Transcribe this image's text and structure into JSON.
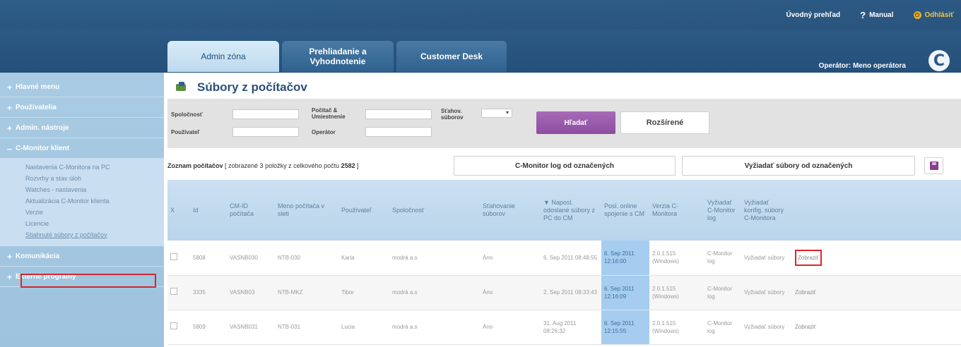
{
  "header": {
    "toplinks": {
      "overview": "Úvodný prehľad",
      "manual_icon": "?",
      "manual": "Manual",
      "logout": "Odhlásiť"
    },
    "tabs": [
      {
        "label": "Admin zóna"
      },
      {
        "label": "Prehliadanie a Vyhodnotenie"
      },
      {
        "label": "Customer Desk"
      }
    ],
    "operator": "Operátor: Meno operátora",
    "logo_letter": "C"
  },
  "sidebar": {
    "items": [
      {
        "label": "Hlavné menu",
        "icon": "+"
      },
      {
        "label": "Používatelia",
        "icon": "+"
      },
      {
        "label": "Admin. nástroje",
        "icon": "+"
      },
      {
        "label": "C-Monitor klient",
        "icon": "–"
      }
    ],
    "sub_items": [
      "Nastavenia C-Monitora na PC",
      "Rozvrhy a stav úloh",
      "Watches - nastavenia",
      "Aktualizácia C-Monitor klienta",
      "Verzie",
      "Licencie",
      "Stiahnuté súbory z počítačov"
    ],
    "bottom_items": [
      {
        "label": "Komunikácia",
        "icon": "+"
      },
      {
        "label": "Externé programy",
        "icon": "+"
      }
    ]
  },
  "main": {
    "title": "Súbory z počítačov",
    "filter": {
      "company_label": "Spoločnosť",
      "user_label": "Používateľ",
      "pc_label": "Počítač & Umiestnenie",
      "operator_label": "Operátor",
      "downloads_label": "Sťahov. súborov",
      "downloads_value": "▾",
      "search_button": "Hľadať",
      "advanced_button": "Rozšírené"
    },
    "list": {
      "prefix": "Zoznam počítačov",
      "bracket_text": "[ zobrazené 3 položky z celkového počtu ",
      "total": "2582",
      "bracket_end": " ]",
      "log_button": "C-Monitor log od označených",
      "request_button": "Vyžiadať súbory od označených"
    },
    "table": {
      "headers": [
        "X",
        "Id",
        "CM-ID počítača",
        "Meno počítača v sieti",
        "Používateľ",
        "Spoločnosť",
        "Sťahovanie súborov",
        "▼ Naposl. odoslané súbory z PC do CM",
        "Posl. online spojenie s CM",
        "Verzia C-Monitora",
        "Vyžiadať C-Monitor log",
        "Vyžiadať konfig. súbory C-Monitora",
        ""
      ],
      "rows": [
        {
          "id": "5808",
          "cmid": "VASNB030",
          "pc": "NTB-030",
          "user": "Karla",
          "company": "modrá a.s",
          "download": "Áno",
          "last_sent": "6. Sep 2011 08:48:55",
          "last_online": "6. Sep 2011 12:16:00",
          "version": "2.0.1.515 (Windows)",
          "log": "C-Monitor log",
          "request": "Vyžiadať súbory",
          "show": "Zobraziť"
        },
        {
          "id": "3335",
          "cmid": "VASNB03",
          "pc": "NTB-MKZ",
          "user": "Tibor",
          "company": "modrá a.s",
          "download": "Áno",
          "last_sent": "2. Sep 2011 08:33:43",
          "last_online": "6. Sep 2011 12:16:09",
          "version": "2.0.1.515 (Windows)",
          "log": "C-Monitor log",
          "request": "Vyžiadať súbory",
          "show": "Zobraziť"
        },
        {
          "id": "5809",
          "cmid": "VASNB031",
          "pc": "NTB-031",
          "user": "Lucia",
          "company": "modrá a.s",
          "download": "Áno",
          "last_sent": "31. Aug 2011 08:26:32",
          "last_online": "6. Sep 2011 12:15:55",
          "version": "2.0.1.515 (Windows)",
          "log": "C-Monitor log",
          "request": "Vyžiadať súbory",
          "show": "Zobraziť"
        }
      ]
    }
  },
  "colors": {
    "header_blue": "#2c5a84",
    "sidebar_blue": "#a9cbe3",
    "search_purple": "#8e4da2",
    "highlight_red": "#d9262c",
    "online_cell": "#a6cdef"
  },
  "icons": {
    "help": "question-icon",
    "logout": "power-icon",
    "page": "files-icon",
    "save": "floppy-icon"
  }
}
